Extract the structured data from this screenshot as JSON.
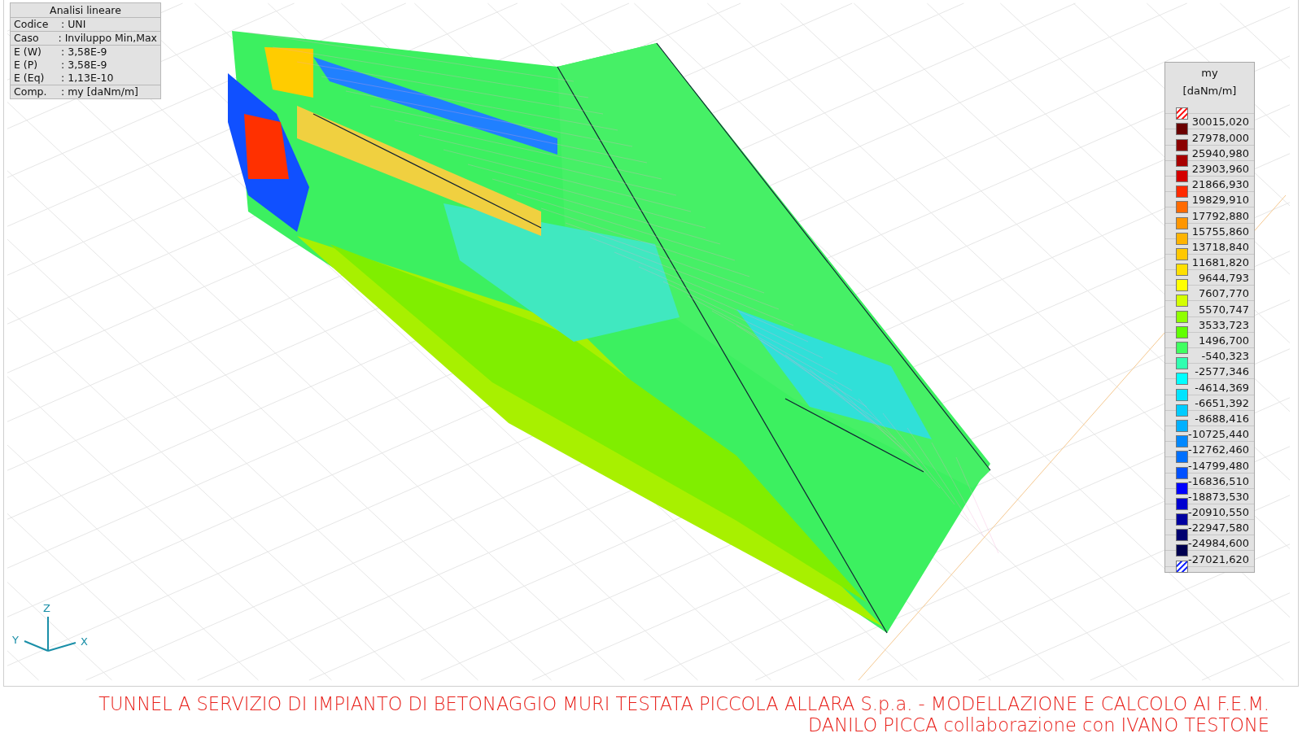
{
  "info_box": {
    "title": "Analisi lineare",
    "groups": [
      [
        {
          "label": "Codice",
          "value": ": UNI"
        }
      ],
      [
        {
          "label": "Caso",
          "value": ": Inviluppo Min,Max"
        }
      ],
      [
        {
          "label": "E (W)",
          "value": ": 3,58E-9"
        },
        {
          "label": "E (P)",
          "value": ": 3,58E-9"
        },
        {
          "label": "E (Eq)",
          "value": ": 1,13E-10"
        }
      ],
      [
        {
          "label": "Comp.",
          "value": ": my [daNm/m]"
        }
      ]
    ]
  },
  "legend": {
    "title": "my",
    "unit": "[daNm/m]",
    "items": [
      {
        "kind": "hatch",
        "color": "#ff2020"
      },
      {
        "kind": "solid",
        "color": "#6a0000",
        "value": "30015,020"
      },
      {
        "kind": "solid",
        "color": "#8b0000",
        "value": "27978,000"
      },
      {
        "kind": "solid",
        "color": "#a80000",
        "value": "25940,980"
      },
      {
        "kind": "solid",
        "color": "#d40000",
        "value": "23903,960"
      },
      {
        "kind": "solid",
        "color": "#ff2a00",
        "value": "21866,930"
      },
      {
        "kind": "solid",
        "color": "#ff6a00",
        "value": "19829,910"
      },
      {
        "kind": "solid",
        "color": "#ff9600",
        "value": "17792,880"
      },
      {
        "kind": "solid",
        "color": "#ffb400",
        "value": "15755,860"
      },
      {
        "kind": "solid",
        "color": "#ffc800",
        "value": "13718,840"
      },
      {
        "kind": "solid",
        "color": "#ffe000",
        "value": "11681,820"
      },
      {
        "kind": "solid",
        "color": "#ffff00",
        "value": "9644,793"
      },
      {
        "kind": "solid",
        "color": "#d4ff00",
        "value": "7607,770"
      },
      {
        "kind": "solid",
        "color": "#90ff00",
        "value": "5570,747"
      },
      {
        "kind": "solid",
        "color": "#60ff00",
        "value": "3533,723"
      },
      {
        "kind": "solid",
        "color": "#40ff60",
        "value": "1496,700"
      },
      {
        "kind": "solid",
        "color": "#30ffb0",
        "value": "-540,323"
      },
      {
        "kind": "solid",
        "color": "#00ffff",
        "value": "-2577,346"
      },
      {
        "kind": "solid",
        "color": "#00e4ff",
        "value": "-4614,369"
      },
      {
        "kind": "solid",
        "color": "#00ccff",
        "value": "-6651,392"
      },
      {
        "kind": "solid",
        "color": "#00b0ff",
        "value": "-8688,416"
      },
      {
        "kind": "solid",
        "color": "#0088ff",
        "value": "-10725,440"
      },
      {
        "kind": "solid",
        "color": "#0070ff",
        "value": "-12762,460"
      },
      {
        "kind": "solid",
        "color": "#0050ff",
        "value": "-14799,480"
      },
      {
        "kind": "solid",
        "color": "#0000ff",
        "value": "-16836,510"
      },
      {
        "kind": "solid",
        "color": "#0000d0",
        "value": "-18873,530"
      },
      {
        "kind": "solid",
        "color": "#0000a0",
        "value": "-20910,550"
      },
      {
        "kind": "solid",
        "color": "#000070",
        "value": "-22947,580"
      },
      {
        "kind": "solid",
        "color": "#000050",
        "value": "-24984,600"
      },
      {
        "kind": "hatch",
        "color": "#2030ff",
        "value": "-27021,620"
      }
    ]
  },
  "axes": {
    "z": "Z",
    "y": "Y",
    "x": "X"
  },
  "caption": [
    "TUNNEL A SERVIZIO DI IMPIANTO DI BETONAGGIO MURI TESTATA PICCOLA ALLARA S.p.a. - MODELLAZIONE E CALCOLO AI F.E.M.",
    "DANILO PICCA collaborazione con IVANO TESTONE"
  ]
}
